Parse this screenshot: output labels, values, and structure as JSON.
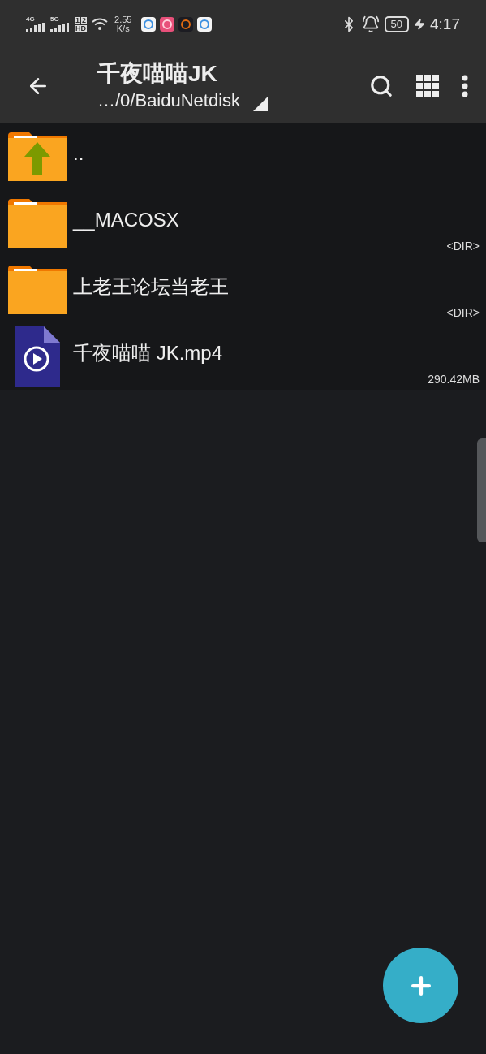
{
  "status_bar": {
    "signal_1": "4G",
    "signal_2": "5G",
    "sim_1": "1",
    "sim_2": "2",
    "hd": "HD",
    "speed": "2.55",
    "speed_unit": "K/s",
    "battery": "50",
    "time": "4:17"
  },
  "toolbar": {
    "title": "千夜喵喵JK",
    "path": "…/0/BaiduNetdisk"
  },
  "files": [
    {
      "kind": "up",
      "name": ".."
    },
    {
      "kind": "folder",
      "name": "__MACOSX",
      "info": "<DIR>"
    },
    {
      "kind": "folder",
      "name": "上老王论坛当老王",
      "info": "<DIR>"
    },
    {
      "kind": "video",
      "name": "千夜喵喵 JK.mp4",
      "info": "290.42MB"
    }
  ]
}
